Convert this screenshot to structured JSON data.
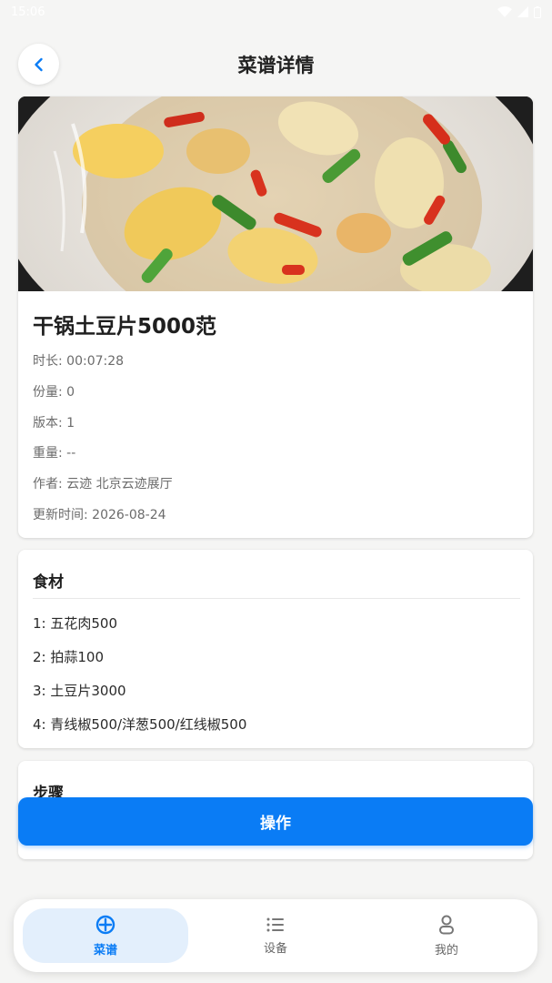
{
  "status_bar": {
    "time": "15:06"
  },
  "header": {
    "title": "菜谱详情"
  },
  "recipe": {
    "name": "干锅土豆片5000范",
    "info": [
      "时长: 00:07:28",
      "份量: 0",
      "版本: 1",
      "重量: --",
      "作者: 云迹 北京云迹展厅",
      "更新时间: 2026-08-24"
    ]
  },
  "ingredients": {
    "title": "食材",
    "items": [
      "1: 五花肉500",
      "2: 拍蒜100",
      "3: 土豆片3000",
      "4: 青线椒500/洋葱500/红线椒500"
    ]
  },
  "steps": {
    "title": "步骤"
  },
  "action": {
    "label": "操作"
  },
  "tabbar": {
    "tabs": [
      {
        "label": "菜谱",
        "icon": "plus-circle-icon",
        "active": true
      },
      {
        "label": "设备",
        "icon": "list-icon",
        "active": false
      },
      {
        "label": "我的",
        "icon": "person-icon",
        "active": false
      }
    ]
  },
  "colors": {
    "accent": "#0a7cf5",
    "tab_active_bg": "#e3effc",
    "background": "#f5f5f4"
  }
}
